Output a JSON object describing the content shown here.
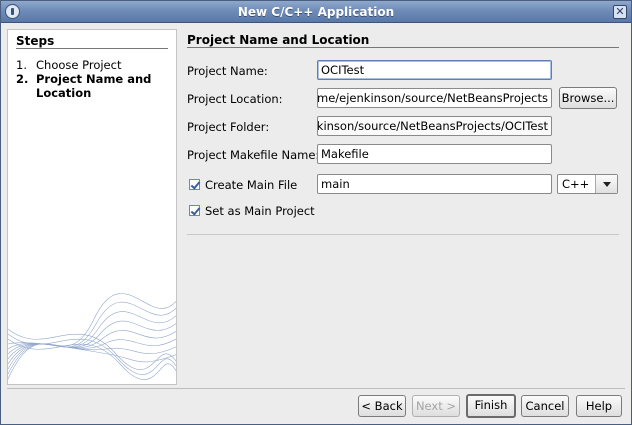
{
  "window": {
    "title": "New C/C++ Application"
  },
  "steps": {
    "heading": "Steps",
    "items": [
      {
        "number": "1.",
        "label": "Choose Project",
        "current": false
      },
      {
        "number": "2.",
        "label": "Project Name and Location",
        "current": true
      }
    ]
  },
  "content": {
    "heading": "Project Name and Location",
    "project_name": {
      "label": "Project Name:",
      "value": "OCITest"
    },
    "project_location": {
      "label": "Project Location:",
      "value": "/home/ejenkinson/source/NetBeansProjects",
      "browse_label": "Browse..."
    },
    "project_folder": {
      "label": "Project Folder:",
      "value": "/home/ejenkinson/source/NetBeansProjects/OCITest"
    },
    "makefile": {
      "label": "Project Makefile Name:",
      "value": "Makefile"
    },
    "create_main_file": {
      "label": "Create Main File",
      "checked": true,
      "value": "main",
      "language": "C++"
    },
    "set_as_main": {
      "label": "Set as Main Project",
      "checked": true
    }
  },
  "footer": {
    "back_label": "< Back",
    "next_label": "Next >",
    "finish_label": "Finish",
    "cancel_label": "Cancel",
    "help_label": "Help"
  }
}
